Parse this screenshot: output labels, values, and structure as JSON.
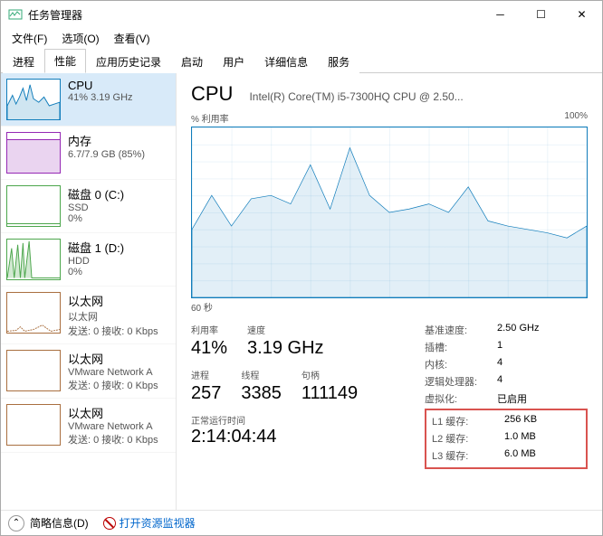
{
  "window": {
    "title": "任务管理器"
  },
  "menu": {
    "file": "文件(F)",
    "options": "选项(O)",
    "view": "查看(V)"
  },
  "tabs": [
    "进程",
    "性能",
    "应用历史记录",
    "启动",
    "用户",
    "详细信息",
    "服务"
  ],
  "active_tab": 1,
  "sidebar": [
    {
      "name": "CPU",
      "sub": "41% 3.19 GHz",
      "type": "cpu",
      "selected": true
    },
    {
      "name": "内存",
      "sub": "6.7/7.9 GB (85%)",
      "type": "mem"
    },
    {
      "name": "磁盘 0 (C:)",
      "sub": "SSD",
      "sub2": "0%",
      "type": "disk"
    },
    {
      "name": "磁盘 1 (D:)",
      "sub": "HDD",
      "sub2": "0%",
      "type": "disk1"
    },
    {
      "name": "以太网",
      "sub": "以太网",
      "sub2": "发送: 0 接收: 0 Kbps",
      "type": "eth"
    },
    {
      "name": "以太网",
      "sub": "VMware Network A",
      "sub2": "发送: 0 接收: 0 Kbps",
      "type": "eth"
    },
    {
      "name": "以太网",
      "sub": "VMware Network A",
      "sub2": "发送: 0 接收: 0 Kbps",
      "type": "eth"
    }
  ],
  "main": {
    "title": "CPU",
    "subtitle": "Intel(R) Core(TM) i5-7300HQ CPU @ 2.50...",
    "chart_top_left": "% 利用率",
    "chart_top_right": "100%",
    "chart_bottom_left": "60 秒",
    "stats_labels": {
      "util": "利用率",
      "speed": "速度",
      "proc": "进程",
      "threads": "线程",
      "handles": "句柄",
      "uptime": "正常运行时间"
    },
    "stats_values": {
      "util": "41%",
      "speed": "3.19 GHz",
      "proc": "257",
      "threads": "3385",
      "handles": "111149",
      "uptime": "2:14:04:44"
    },
    "right": {
      "base_speed_l": "基准速度:",
      "base_speed_v": "2.50 GHz",
      "sockets_l": "插槽:",
      "sockets_v": "1",
      "cores_l": "内核:",
      "cores_v": "4",
      "lprocs_l": "逻辑处理器:",
      "lprocs_v": "4",
      "virt_l": "虚拟化:",
      "virt_v": "已启用",
      "l1_l": "L1 缓存:",
      "l1_v": "256 KB",
      "l2_l": "L2 缓存:",
      "l2_v": "1.0 MB",
      "l3_l": "L3 缓存:",
      "l3_v": "6.0 MB"
    }
  },
  "footer": {
    "brief": "简略信息(D)",
    "resmon": "打开资源监视器"
  },
  "chart_data": {
    "type": "line",
    "title": "% 利用率",
    "xlabel": "60 秒",
    "ylabel": "",
    "ylim": [
      0,
      100
    ],
    "x_seconds_ago": [
      60,
      57,
      54,
      51,
      48,
      45,
      42,
      39,
      36,
      33,
      30,
      27,
      24,
      21,
      18,
      15,
      12,
      9,
      6,
      3,
      0
    ],
    "values": [
      40,
      60,
      42,
      58,
      60,
      55,
      78,
      52,
      88,
      60,
      50,
      52,
      55,
      50,
      65,
      45,
      42,
      40,
      38,
      35,
      42
    ]
  }
}
